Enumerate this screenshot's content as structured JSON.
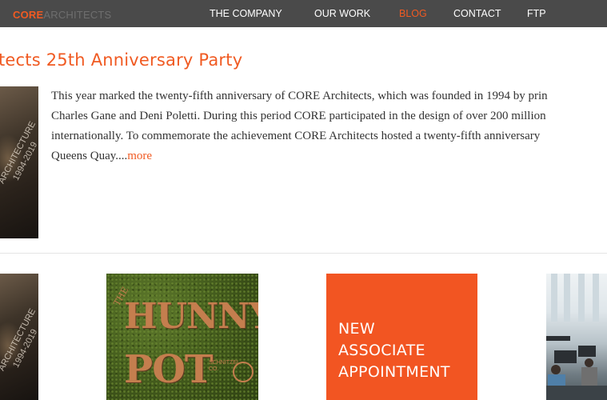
{
  "header": {
    "logo_bold": "CORE",
    "logo_light": "ARCHITECTS",
    "nav": [
      {
        "label": "THE COMPANY"
      },
      {
        "label": "OUR WORK"
      },
      {
        "label": "BLOG",
        "active": true
      },
      {
        "label": "CONTACT"
      },
      {
        "label": "FTP"
      }
    ]
  },
  "post": {
    "title": "tects 25th Anniversary Party",
    "excerpt_lines": [
      "This year marked the twenty-fifth anniversary of CORE Architects, which was founded in 1994 by prin",
      "Charles Gane and Deni Poletti. During this period CORE participated in the design of over 200 million",
      "internationally. To commemorate the achievement CORE Architects hosted a twenty-fifth anniversary",
      "Queens Quay...."
    ],
    "more_label": "more",
    "poster_text": [
      "ARCHITECTURE",
      "1994-2019"
    ]
  },
  "grid": {
    "hunny": {
      "small": "THE",
      "line1": "HUNNY",
      "line2": "POT",
      "tag": "SCHNITZEL\nCO."
    },
    "associate": {
      "lines": [
        "NEW",
        "ASSOCIATE",
        "APPOINTMENT"
      ]
    }
  },
  "colors": {
    "accent": "#f05a22",
    "nav_bg": "#4a4a4a",
    "associate_bg": "#f25522"
  }
}
